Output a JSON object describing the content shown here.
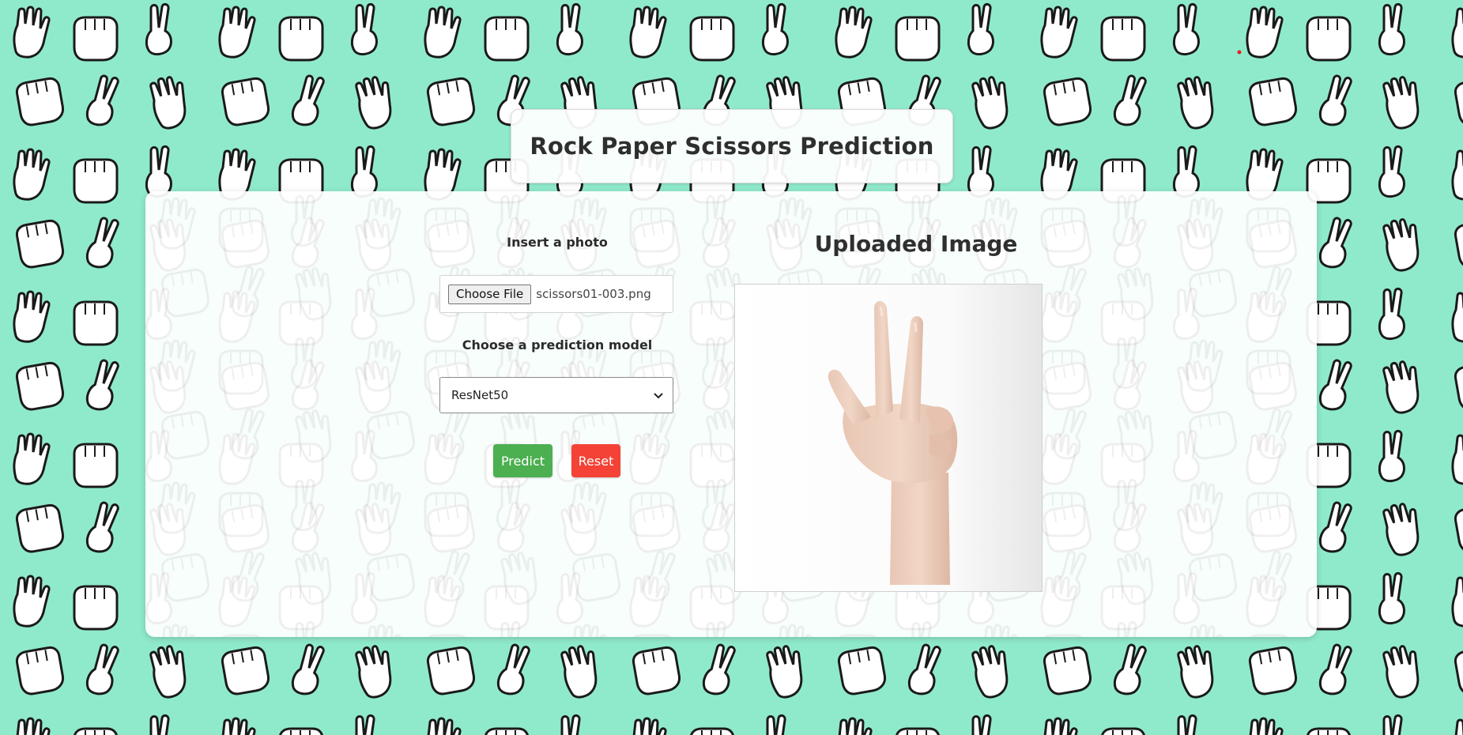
{
  "page": {
    "title": "Rock Paper Scissors Prediction",
    "background_color": "#8feacb"
  },
  "form": {
    "photo_label": "Insert a photo",
    "choose_file_label": "Choose File",
    "file_name": "scissors01-003.png",
    "model_label": "Choose a prediction model",
    "model_selected": "ResNet50",
    "predict_label": "Predict",
    "reset_label": "Reset",
    "predict_color": "#4caf50",
    "reset_color": "#f44336"
  },
  "preview": {
    "title": "Uploaded Image",
    "image_icon": "hand-scissors-photo"
  },
  "icons": {
    "select_arrow": "chevron-down-icon",
    "background": "hand-pattern"
  }
}
